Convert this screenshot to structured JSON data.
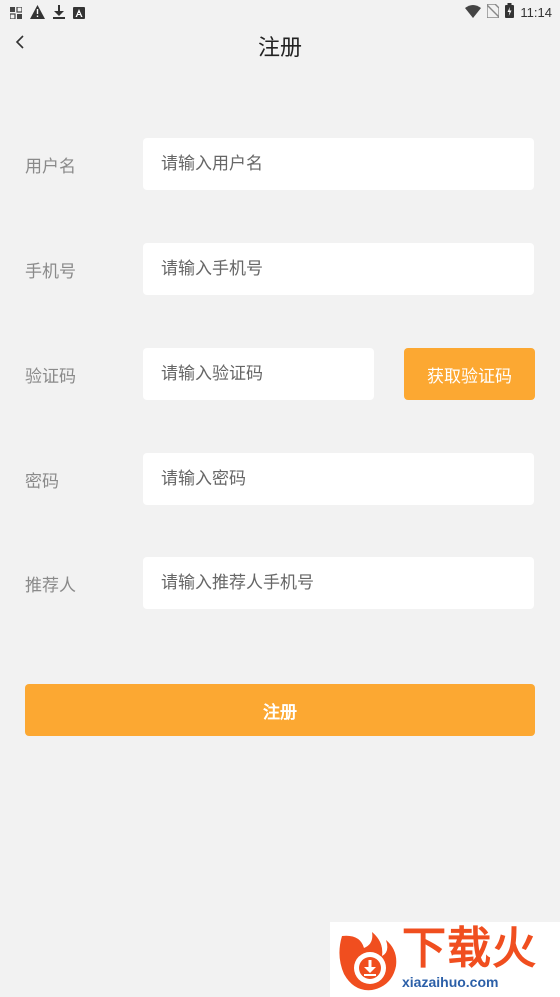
{
  "status_bar": {
    "time": "11:14",
    "left_icons": [
      "notification-icon",
      "warning-icon",
      "download-icon",
      "a-badge-icon"
    ],
    "right_icons": [
      "wifi-icon",
      "no-sim-icon",
      "battery-icon"
    ]
  },
  "header": {
    "title": "注册",
    "back_icon": "chevron-left-icon"
  },
  "form": {
    "username": {
      "label": "用户名",
      "placeholder": "请输入用户名",
      "value": ""
    },
    "phone": {
      "label": "手机号",
      "placeholder": "请输入手机号",
      "value": ""
    },
    "code": {
      "label": "验证码",
      "placeholder": "请输入验证码",
      "value": "",
      "button_label": "获取验证码"
    },
    "password": {
      "label": "密码",
      "placeholder": "请输入密码",
      "value": ""
    },
    "referrer": {
      "label": "推荐人",
      "placeholder": "请输入推荐人手机号",
      "value": ""
    }
  },
  "submit": {
    "label": "注册"
  },
  "watermark": {
    "title": "下载火",
    "subtitle": "xiazaihuo.com"
  },
  "colors": {
    "accent": "#fca832",
    "background": "#f2f2f2",
    "field_bg": "#ffffff",
    "label": "#8a8a8a",
    "watermark_red": "#f04e1f",
    "watermark_blue": "#2b5fa8"
  }
}
